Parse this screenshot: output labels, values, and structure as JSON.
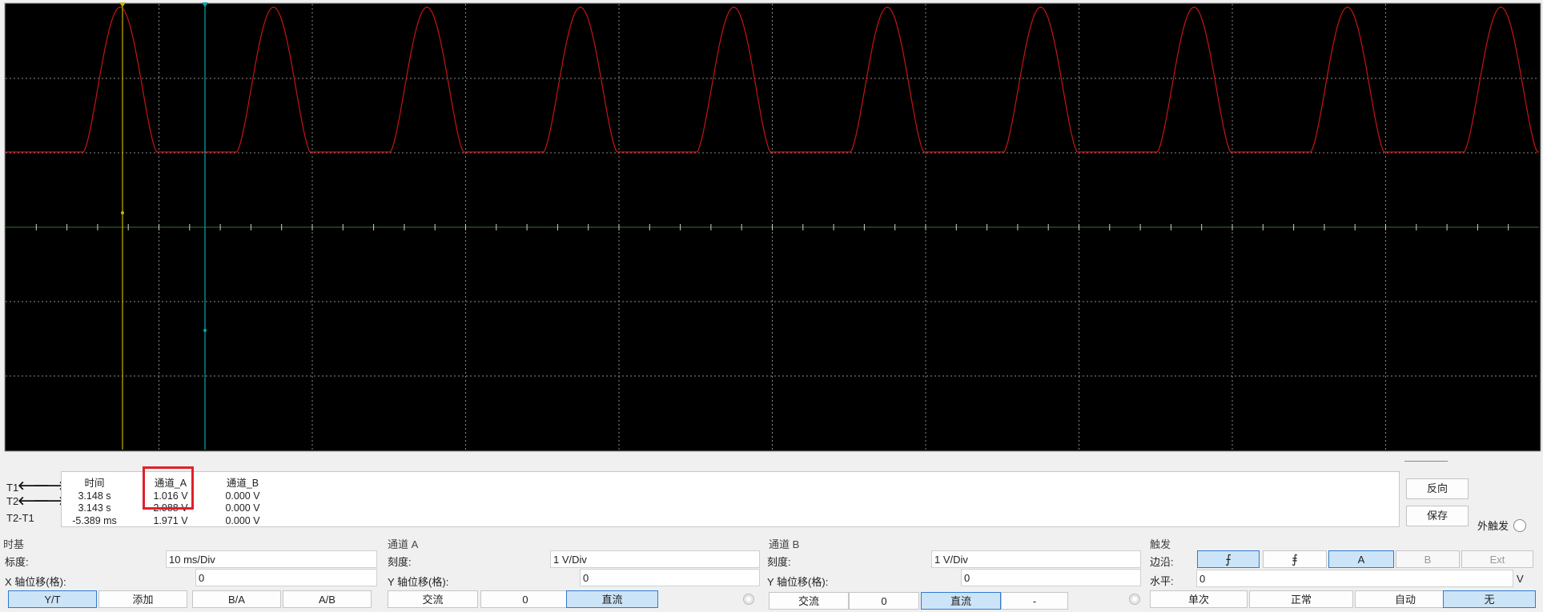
{
  "colors": {
    "screen_bg": "#000000",
    "grid": "#8a8a8a",
    "trace_a": "#c81414",
    "cursor_t1": "#c8b400",
    "cursor_t2": "#00a8b0",
    "axis_marker": "#2a7a2a",
    "highlight": "#e0202a",
    "selected_button": "#cce4f7"
  },
  "readout": {
    "t1_label": "T1",
    "t2_label": "T2",
    "diff_label": "T2-T1",
    "arrow_left": "🡐",
    "arrow_right": "🡒",
    "headers": {
      "time": "时间",
      "channel_a": "通道_A",
      "channel_b": "通道_B"
    },
    "time": [
      "3.148 s",
      "3.143 s",
      "-5.389 ms"
    ],
    "channel_a": [
      "1.016 V",
      "2.988 V",
      "1.971 V"
    ],
    "channel_b": [
      "0.000 V",
      "0.000 V",
      "0.000 V"
    ]
  },
  "side": {
    "reverse": "反向",
    "save": "保存",
    "ext_trigger": "外触发"
  },
  "timebase": {
    "title": "时基",
    "scale_label": "标度:",
    "scale_value": "10 ms/Div",
    "xpos_label": "X 轴位移(格):",
    "xpos_value": "0",
    "modes": [
      "Y/T",
      "添加",
      "B/A",
      "A/B"
    ]
  },
  "channel_a": {
    "title": "通道 A",
    "scale_label": "刻度:",
    "scale_value": "1  V/Div",
    "ypos_label": "Y 轴位移(格):",
    "ypos_value": "0",
    "coupling": [
      "交流",
      "0",
      "直流"
    ]
  },
  "channel_b": {
    "title": "通道 B",
    "scale_label": "刻度:",
    "scale_value": "1  V/Div",
    "ypos_label": "Y 轴位移(格):",
    "ypos_value": "0",
    "coupling": [
      "交流",
      "0",
      "直流",
      "-"
    ]
  },
  "trigger": {
    "title": "触发",
    "edge_label": "边沿:",
    "edge_rising": "⨍",
    "edge_falling": "⨎",
    "source": [
      "A",
      "B",
      "Ext"
    ],
    "level_label": "水平:",
    "level_value": "0",
    "level_unit": "V",
    "modes": [
      "单次",
      "正常",
      "自动",
      "无"
    ]
  }
}
